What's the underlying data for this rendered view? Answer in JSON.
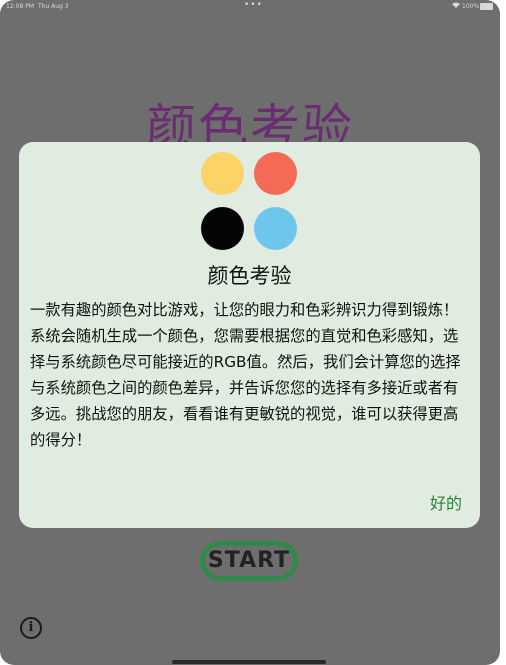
{
  "status_bar": {
    "time": "12:08 PM",
    "date": "Thu Aug 3",
    "dots": "•••",
    "wifi_icon": "wifi-icon",
    "battery_text": "100%"
  },
  "background": {
    "title": "颜色考验",
    "start_label": "START",
    "info_label": "i"
  },
  "dialog": {
    "dots": [
      {
        "name": "yellow",
        "color": "#fcd367"
      },
      {
        "name": "red",
        "color": "#f56a57"
      },
      {
        "name": "black",
        "color": "#050505"
      },
      {
        "name": "blue",
        "color": "#6fc6ec"
      }
    ],
    "title": "颜色考验",
    "body": "一款有趣的颜色对比游戏，让您的眼力和色彩辨识力得到锻炼！系统会随机生成一个颜色，您需要根据您的直觉和色彩感知，选择与系统颜色尽可能接近的RGB值。然后，我们会计算您的选择与系统颜色之间的颜色差异，并告诉您您的选择有多接近或者有多远。挑战您的朋友，看看谁有更敏锐的视觉，谁可以获得更高的得分！",
    "ok_label": "好的"
  },
  "colors": {
    "overlay": "#6e6e6e",
    "title_purple": "#6a2d72",
    "dialog_bg": "#e1ece0",
    "accent_green": "#2e7d3a"
  }
}
